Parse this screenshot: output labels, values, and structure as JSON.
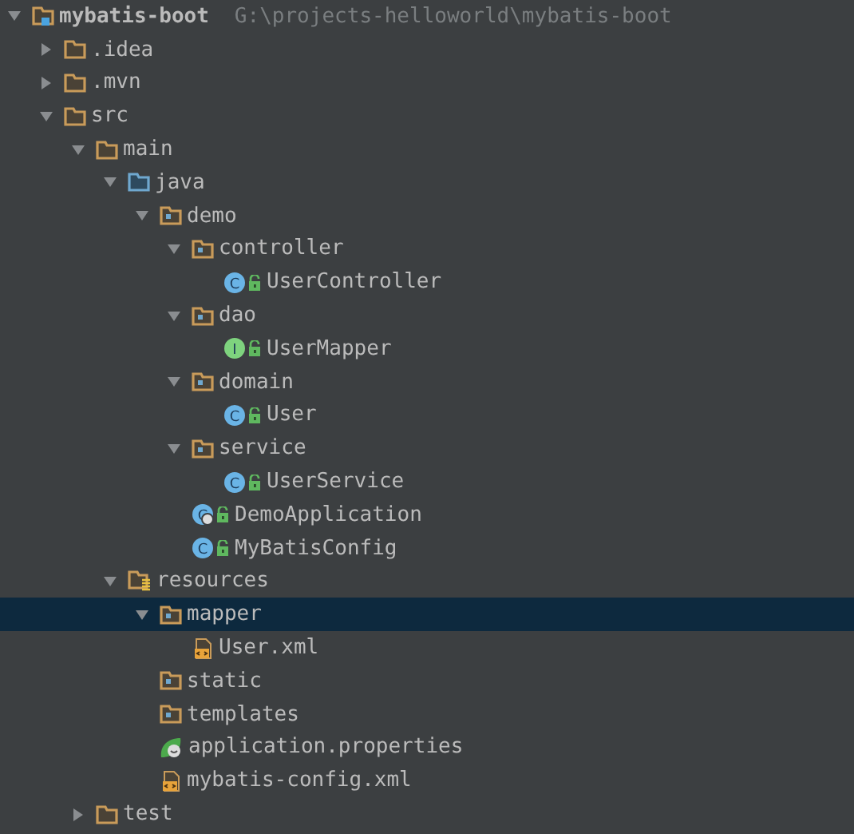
{
  "tree": [
    {
      "kind": "module",
      "label": "mybatis-boot",
      "path": "G:\\projects-helloworld\\mybatis-boot",
      "expanded": true,
      "selected": false,
      "children": [
        {
          "kind": "folder",
          "label": ".idea",
          "expanded": false,
          "selected": false
        },
        {
          "kind": "folder",
          "label": ".mvn",
          "expanded": false,
          "selected": false
        },
        {
          "kind": "folder",
          "label": "src",
          "expanded": true,
          "selected": false,
          "children": [
            {
              "kind": "folder",
              "label": "main",
              "expanded": true,
              "selected": false,
              "children": [
                {
                  "kind": "source",
                  "label": "java",
                  "expanded": true,
                  "selected": false,
                  "children": [
                    {
                      "kind": "package",
                      "label": "demo",
                      "expanded": true,
                      "selected": false,
                      "children": [
                        {
                          "kind": "package",
                          "label": "controller",
                          "expanded": true,
                          "selected": false,
                          "children": [
                            {
                              "kind": "class",
                              "badge": "C",
                              "label": "UserController",
                              "selected": false
                            }
                          ]
                        },
                        {
                          "kind": "package",
                          "label": "dao",
                          "expanded": true,
                          "selected": false,
                          "children": [
                            {
                              "kind": "interface",
                              "badge": "I",
                              "label": "UserMapper",
                              "selected": false
                            }
                          ]
                        },
                        {
                          "kind": "package",
                          "label": "domain",
                          "expanded": true,
                          "selected": false,
                          "children": [
                            {
                              "kind": "class",
                              "badge": "C",
                              "label": "User",
                              "selected": false
                            }
                          ]
                        },
                        {
                          "kind": "package",
                          "label": "service",
                          "expanded": true,
                          "selected": false,
                          "children": [
                            {
                              "kind": "class",
                              "badge": "C",
                              "label": "UserService",
                              "selected": false
                            }
                          ]
                        },
                        {
                          "kind": "boot-class",
                          "badge": "C",
                          "label": "DemoApplication",
                          "selected": false
                        },
                        {
                          "kind": "class",
                          "badge": "C",
                          "label": "MyBatisConfig",
                          "selected": false
                        }
                      ]
                    }
                  ]
                },
                {
                  "kind": "resources",
                  "label": "resources",
                  "expanded": true,
                  "selected": false,
                  "children": [
                    {
                      "kind": "package",
                      "label": "mapper",
                      "expanded": true,
                      "selected": true,
                      "children": [
                        {
                          "kind": "xml",
                          "label": "User.xml",
                          "selected": false
                        }
                      ]
                    },
                    {
                      "kind": "package",
                      "label": "static",
                      "selected": false
                    },
                    {
                      "kind": "package",
                      "label": "templates",
                      "selected": false
                    },
                    {
                      "kind": "properties",
                      "label": "application.properties",
                      "selected": false
                    },
                    {
                      "kind": "xml",
                      "label": "mybatis-config.xml",
                      "selected": false
                    }
                  ]
                }
              ]
            },
            {
              "kind": "folder",
              "label": "test",
              "expanded": false,
              "selected": false
            }
          ]
        }
      ]
    }
  ]
}
